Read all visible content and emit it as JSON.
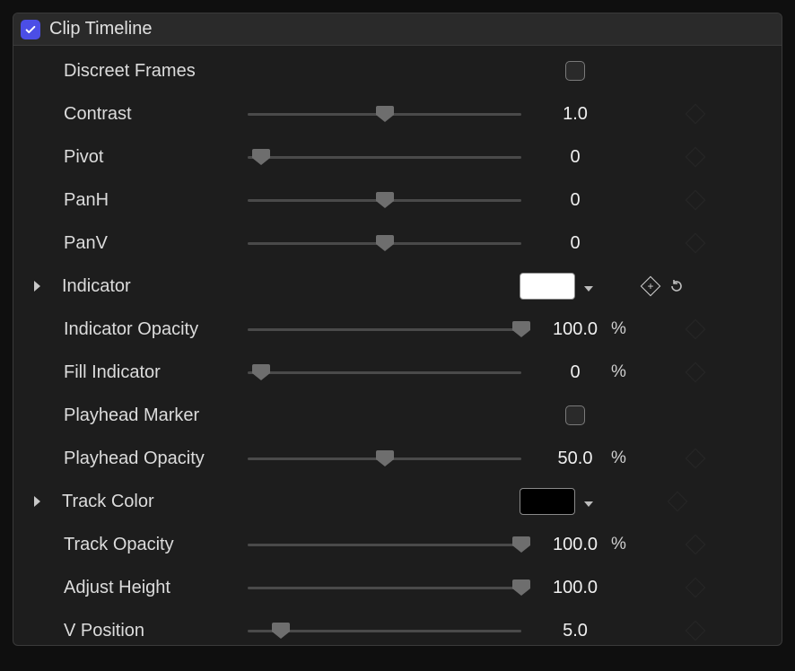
{
  "panel": {
    "enabled": true,
    "title": "Clip Timeline"
  },
  "rows": {
    "discreetFrames": {
      "label": "Discreet Frames",
      "checked": false
    },
    "contrast": {
      "label": "Contrast",
      "value": "1.0",
      "sliderPct": 50
    },
    "pivot": {
      "label": "Pivot",
      "value": "0",
      "sliderPct": 5
    },
    "panH": {
      "label": "PanH",
      "value": "0",
      "sliderPct": 50
    },
    "panV": {
      "label": "PanV",
      "value": "0",
      "sliderPct": 50
    },
    "indicator": {
      "label": "Indicator",
      "color": "#ffffff"
    },
    "indicatorOpacity": {
      "label": "Indicator Opacity",
      "value": "100.0",
      "unit": "%",
      "sliderPct": 100
    },
    "fillIndicator": {
      "label": "Fill Indicator",
      "value": "0",
      "unit": "%",
      "sliderPct": 5
    },
    "playheadMarker": {
      "label": "Playhead Marker",
      "checked": false
    },
    "playheadOpacity": {
      "label": "Playhead Opacity",
      "value": "50.0",
      "unit": "%",
      "sliderPct": 50
    },
    "trackColor": {
      "label": "Track Color",
      "color": "#000000"
    },
    "trackOpacity": {
      "label": "Track Opacity",
      "value": "100.0",
      "unit": "%",
      "sliderPct": 100
    },
    "adjustHeight": {
      "label": "Adjust Height",
      "value": "100.0",
      "sliderPct": 100
    },
    "vPosition": {
      "label": "V Position",
      "value": "5.0",
      "sliderPct": 12
    }
  }
}
